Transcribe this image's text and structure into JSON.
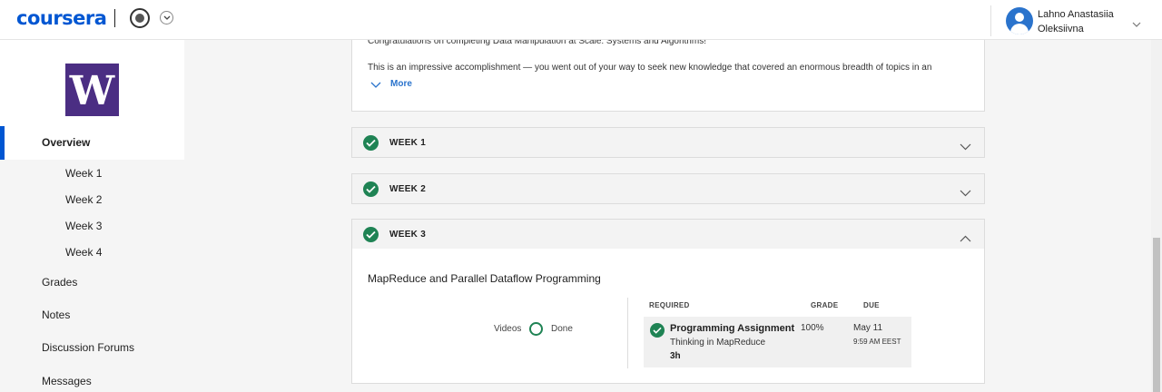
{
  "header": {
    "logo": "coursera",
    "user_name": "Lahno Anastasiia Oleksiivna",
    "user_first_line": "Lahno Anastasiia",
    "user_second_line": "Oleksiivna"
  },
  "sidebar": {
    "university_logo_letter": "W",
    "overview": "Overview",
    "weeks": [
      "Week 1",
      "Week 2",
      "Week 3",
      "Week 4"
    ],
    "grades": "Grades",
    "notes": "Notes",
    "discussion_forums": "Discussion Forums",
    "messages": "Messages"
  },
  "main": {
    "congrats_line1": "Congratulations on completing Data Manipulation at Scale: Systems and Algorithms!",
    "congrats_line2": "This is an impressive accomplishment — you went out of your way to seek new knowledge that covered an enormous breadth of topics in an",
    "more": "More",
    "weeks": [
      {
        "title": "WEEK 1",
        "status": "completed",
        "expanded": false
      },
      {
        "title": "WEEK 2",
        "status": "completed",
        "expanded": false
      },
      {
        "title": "WEEK 3",
        "status": "completed",
        "expanded": true
      }
    ],
    "week3": {
      "lesson_title": "MapReduce and Parallel Dataflow Programming",
      "videos_label": "Videos",
      "videos_status": "Done",
      "columns": {
        "required": "REQUIRED",
        "grade": "GRADE",
        "due": "DUE"
      },
      "assignment": {
        "name": "Programming Assignment",
        "subtitle": "Thinking in MapReduce",
        "duration": "3h",
        "grade": "100%",
        "due_date": "May 11",
        "due_time": "9:59 AM EEST"
      }
    }
  },
  "colors": {
    "brand": "#0056d2",
    "success": "#1f8354",
    "uw_purple": "#4b2e83",
    "link": "#2a73cc"
  }
}
